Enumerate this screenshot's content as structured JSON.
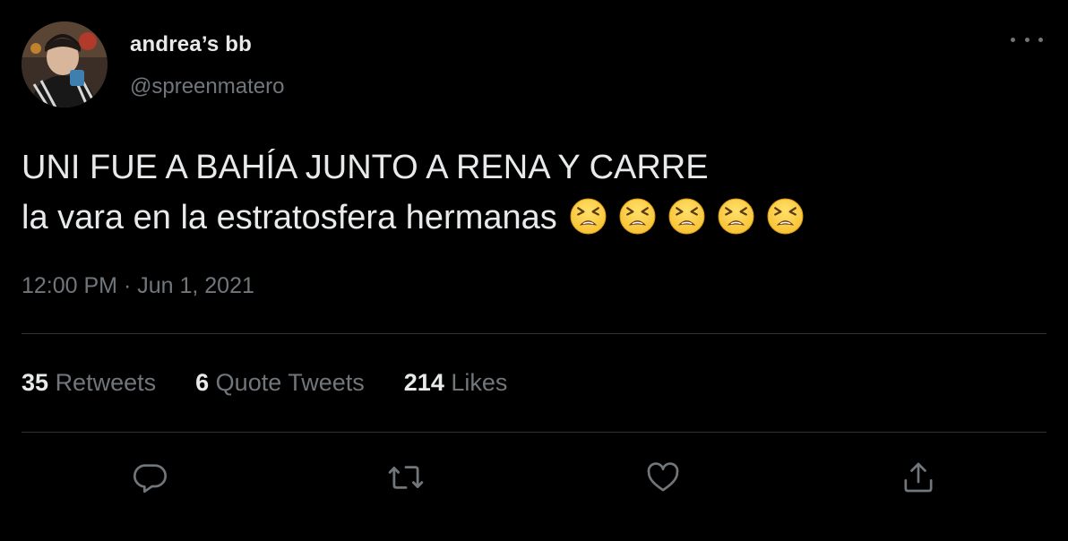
{
  "user": {
    "display_name": "andrea’s bb",
    "handle": "@spreenmatero",
    "avatar_icon": "profile-photo"
  },
  "tweet": {
    "line1": "UNI FUE A BAHÍA JUNTO A RENA Y CARRE",
    "line2": "la vara en la estratosfera hermanas",
    "emoji_name": "tired-face-emoji",
    "emoji_count": 5,
    "timestamp": "12:00 PM · Jun 1, 2021"
  },
  "stats": {
    "retweets_count": "35",
    "retweets_label": "Retweets",
    "quotes_count": "6",
    "quotes_label": "Quote Tweets",
    "likes_count": "214",
    "likes_label": "Likes"
  },
  "actions": [
    "reply-icon",
    "retweet-icon",
    "like-icon",
    "share-icon"
  ],
  "colors": {
    "background": "#000000",
    "primary_text": "#e7e9ea",
    "secondary_text": "#71767b",
    "divider": "#2f3336",
    "emoji_yellow": "#f7c233"
  }
}
